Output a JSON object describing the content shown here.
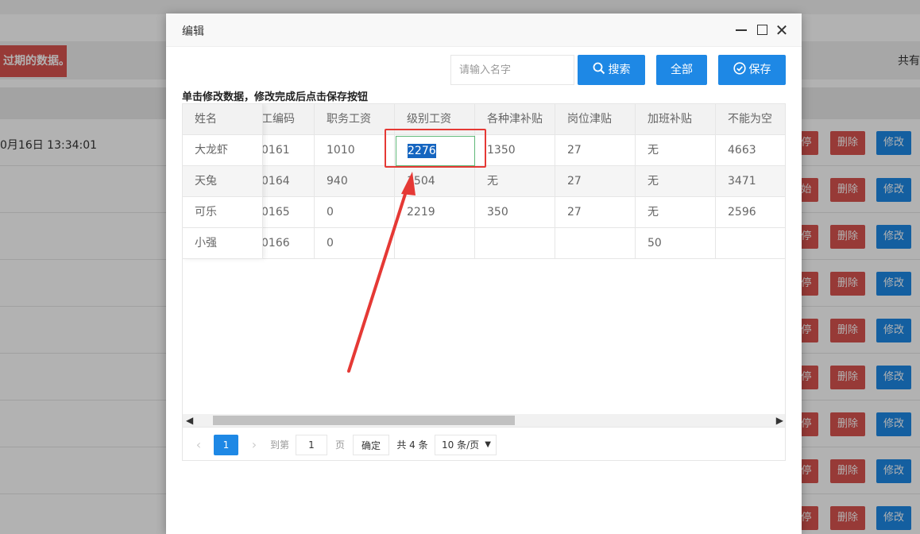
{
  "background": {
    "notice": "过期的数据。",
    "count_label": "共有",
    "date_text": "0月16日 13:34:01",
    "rows": [
      {
        "pause": "停",
        "delete": "删除",
        "edit": "修改"
      },
      {
        "pause": "始",
        "delete": "删除",
        "edit": "修改"
      },
      {
        "pause": "停",
        "delete": "删除",
        "edit": "修改"
      },
      {
        "pause": "停",
        "delete": "删除",
        "edit": "修改"
      },
      {
        "pause": "停",
        "delete": "删除",
        "edit": "修改"
      },
      {
        "pause": "停",
        "delete": "删除",
        "edit": "修改"
      },
      {
        "pause": "停",
        "delete": "删除",
        "edit": "修改"
      },
      {
        "pause": "停",
        "delete": "删除",
        "edit": "修改"
      },
      {
        "pause": "停",
        "delete": "删除",
        "edit": "修改"
      }
    ]
  },
  "modal": {
    "title": "编辑",
    "toolbar": {
      "search_placeholder": "请输入名字",
      "search_label": "搜索",
      "all_label": "全部",
      "save_label": "保存"
    },
    "hint": "单击修改数据，修改完成后点击保存按钮",
    "table": {
      "fixed_header": "姓名",
      "headers": [
        "工编码",
        "职务工资",
        "级别工资",
        "各种津补贴",
        "岗位津贴",
        "加班补贴",
        "不能为空"
      ],
      "rows": [
        {
          "name": "大龙虾",
          "cells": [
            "0161",
            "1010",
            "2276",
            "1350",
            "27",
            "无",
            "4663"
          ]
        },
        {
          "name": "天兔",
          "cells": [
            "0164",
            "940",
            "1504",
            "无",
            "27",
            "无",
            "3471"
          ]
        },
        {
          "name": "可乐",
          "cells": [
            "0165",
            "0",
            "2219",
            "350",
            "27",
            "无",
            "2596"
          ]
        },
        {
          "name": "小强",
          "cells": [
            "0166",
            "0",
            "",
            "",
            "",
            "50",
            ""
          ]
        }
      ],
      "editing_value": "2276"
    },
    "pager": {
      "prev": "‹",
      "current": "1",
      "next": "›",
      "goto_label": "到第",
      "goto_value": "1",
      "page_label": "页",
      "confirm_label": "确定",
      "total_label": "共 4 条",
      "page_size": "10 条/页"
    }
  }
}
